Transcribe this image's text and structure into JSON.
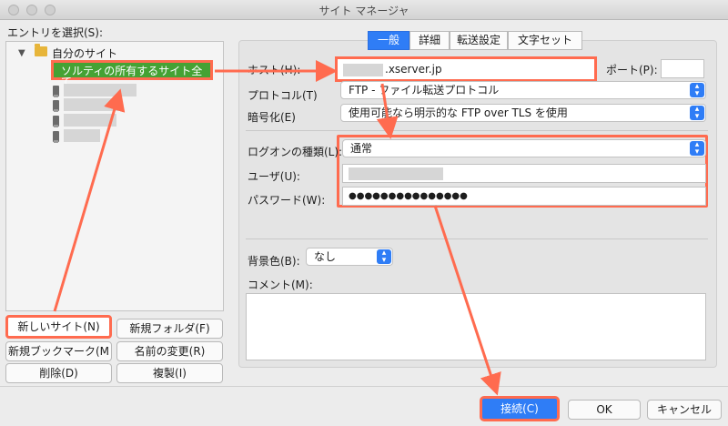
{
  "window": {
    "title": "サイト マネージャ"
  },
  "left": {
    "select_label": "エントリを選択(S):",
    "tree": {
      "root_label": "自分のサイト",
      "selected_site": "ソルティの所有するサイト全て"
    },
    "buttons": {
      "new_site": "新しいサイト(N)",
      "new_folder": "新規フォルダ(F)",
      "new_bookmark": "新規ブックマーク(M",
      "rename": "名前の変更(R)",
      "delete": "削除(D)",
      "duplicate": "複製(I)"
    }
  },
  "tabs": [
    "一般",
    "詳細",
    "転送設定",
    "文字セット"
  ],
  "active_tab": "一般",
  "form": {
    "host_label": "ホスト(H):",
    "host_value": ".xserver.jp",
    "port_label": "ポート(P):",
    "port_value": "",
    "protocol_label": "プロトコル(T)",
    "protocol_value": "FTP - ファイル転送プロトコル",
    "encryption_label": "暗号化(E)",
    "encryption_value": "使用可能なら明示的な FTP over TLS を使用",
    "logon_type_label": "ログオンの種類(L):",
    "logon_type_value": "通常",
    "user_label": "ユーザ(U):",
    "user_value": "",
    "password_label": "パスワード(W):",
    "password_value": "●●●●●●●●●●●●●●●",
    "bg_color_label": "背景色(B):",
    "bg_color_value": "なし",
    "comment_label": "コメント(M):",
    "comment_value": ""
  },
  "footer": {
    "connect": "接続(C)",
    "ok": "OK",
    "cancel": "キャンセル"
  },
  "colors": {
    "accent": "#2f7df6",
    "highlight": "#ff6b4f",
    "selection": "#45a234"
  }
}
